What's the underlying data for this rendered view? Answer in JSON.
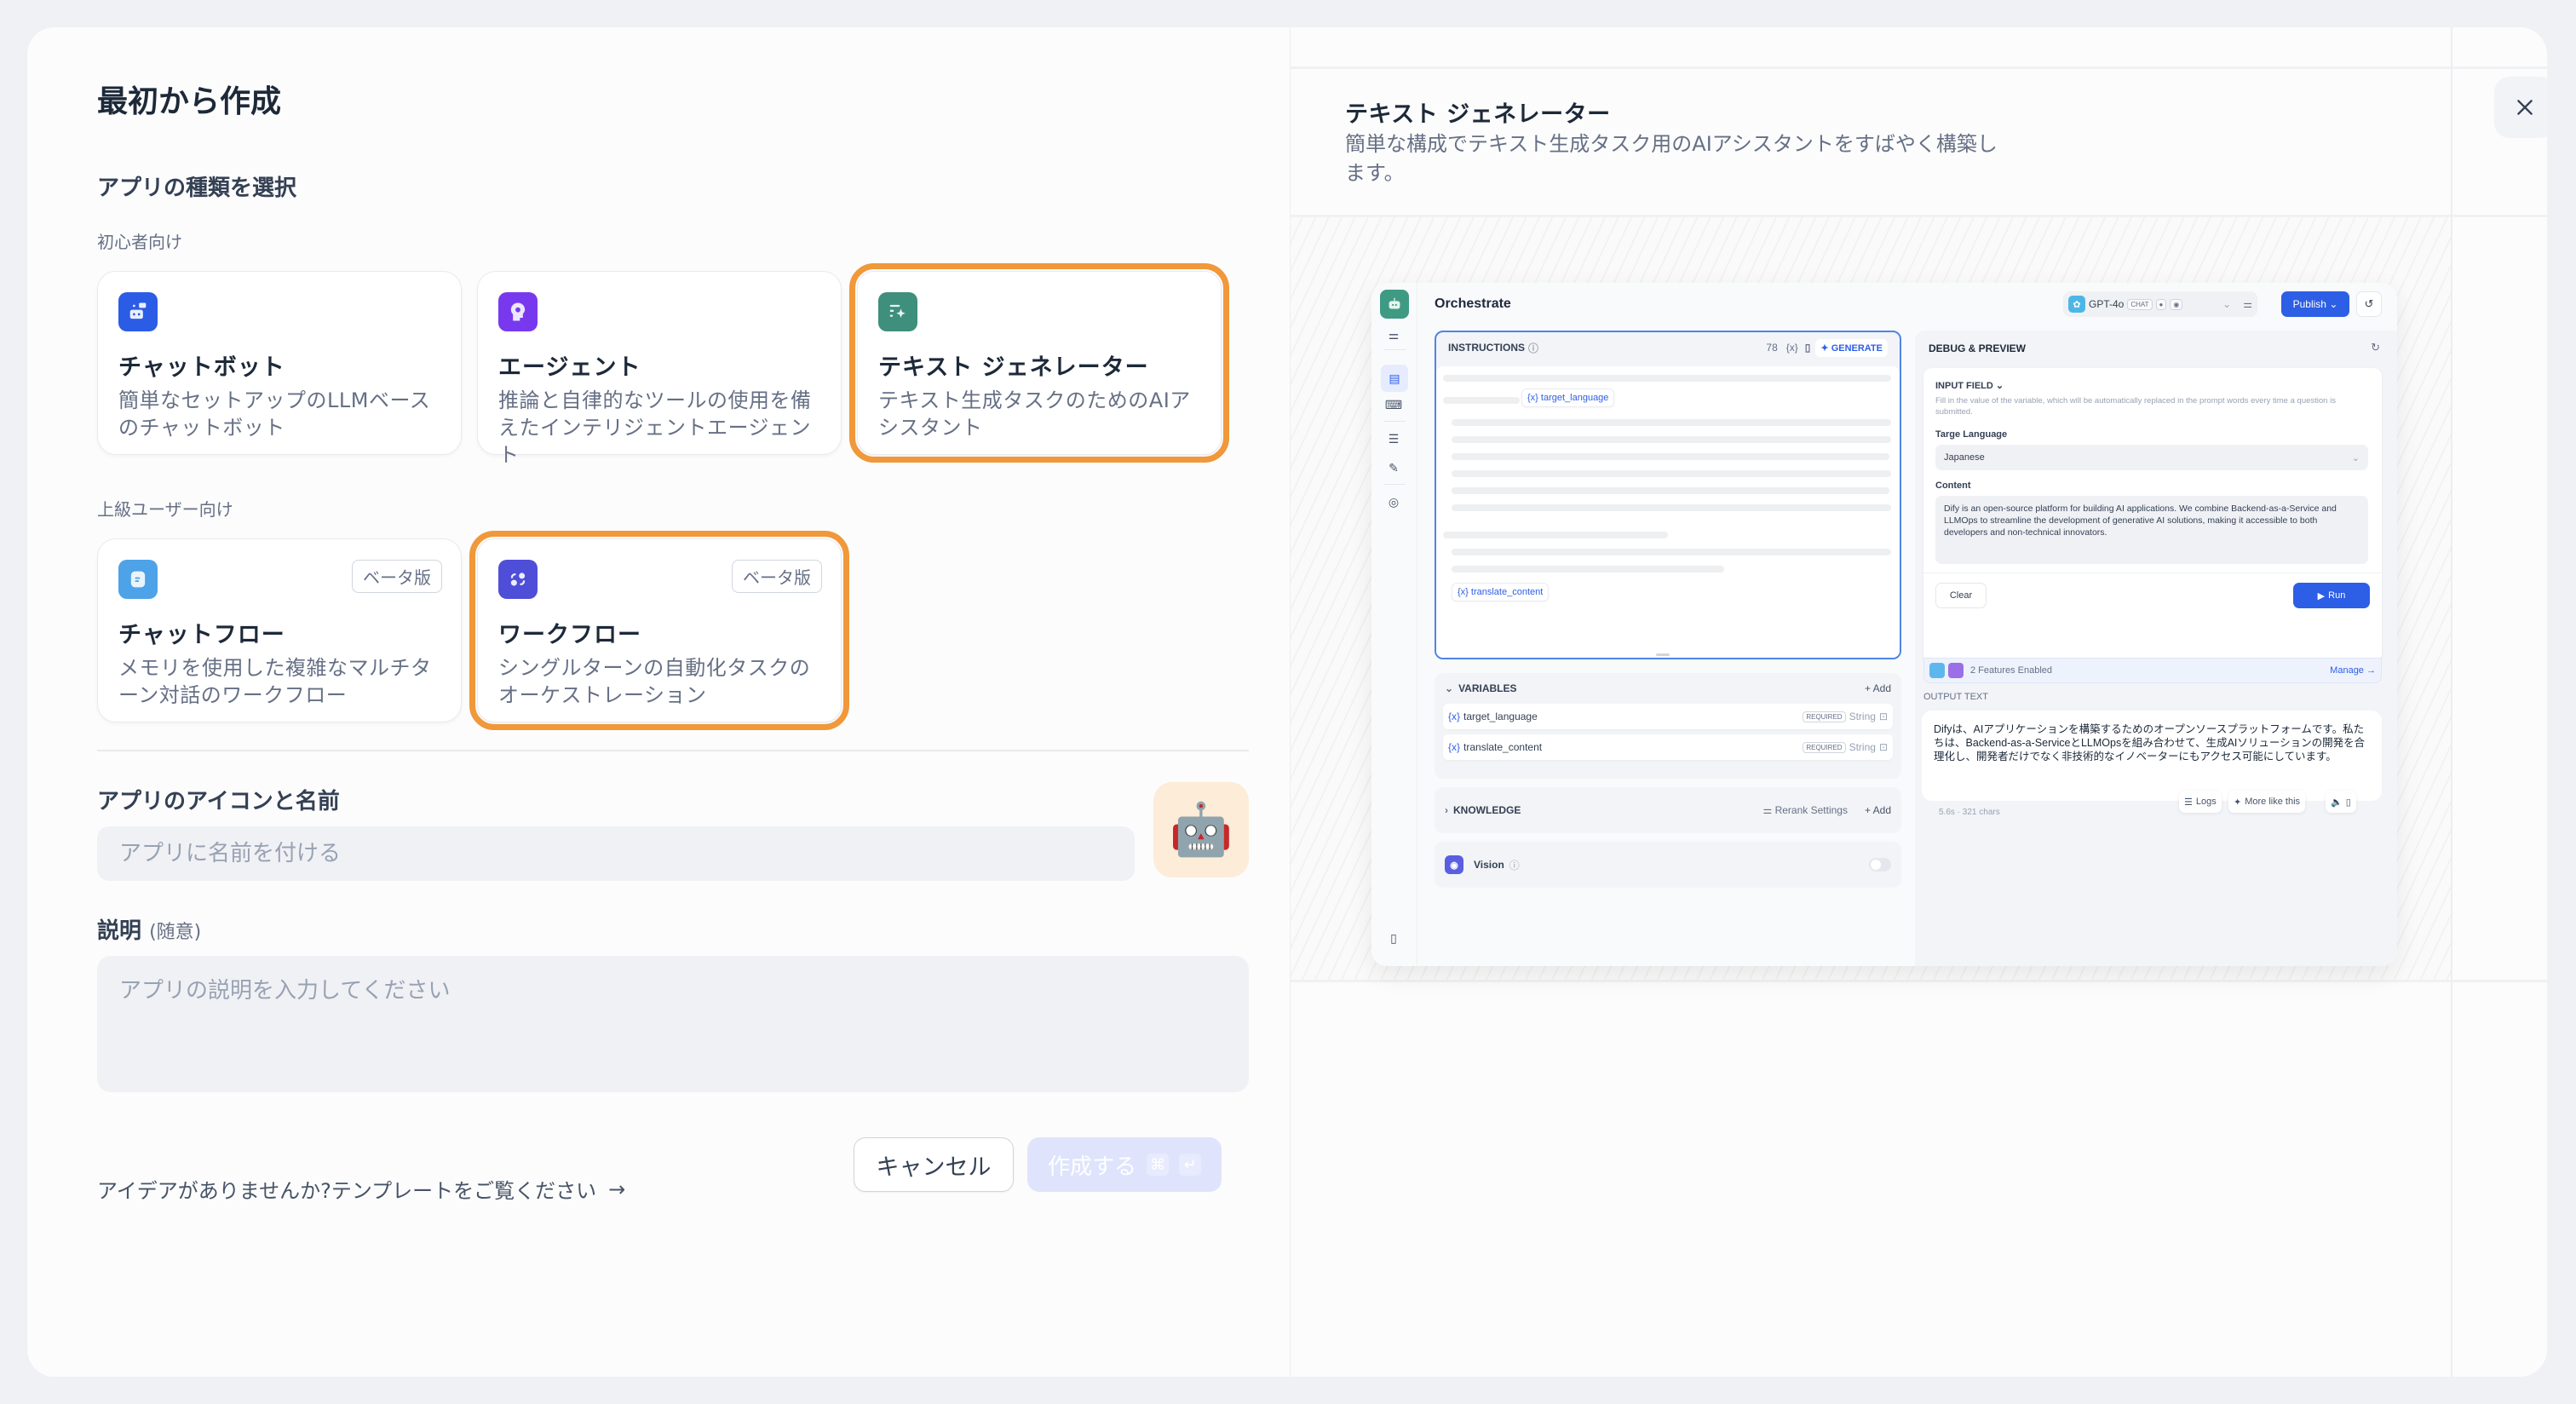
{
  "dialog": {
    "title": "最初から作成",
    "app_type_heading": "アプリの種類を選択",
    "groups": [
      {
        "label": "初心者向け",
        "cards": [
          {
            "name": "チャットボット",
            "desc": "簡単なセットアップのLLMベースのチャットボット",
            "icon": "chatbot-icon",
            "color": "#2b5ce6",
            "selected": false,
            "badge": null
          },
          {
            "name": "エージェント",
            "desc": "推論と自律的なツールの使用を備えたインテリジェントエージェント",
            "icon": "agent-icon",
            "color": "#7839ee",
            "selected": false,
            "badge": null
          },
          {
            "name": "テキスト ジェネレーター",
            "desc": "テキスト生成タスクのためのAIアシスタント",
            "icon": "text-generator-icon",
            "color": "#3f8f7d",
            "selected": true,
            "badge": null
          }
        ]
      },
      {
        "label": "上級ユーザー向け",
        "cards": [
          {
            "name": "チャットフロー",
            "desc": "メモリを使用した複雑なマルチターン対話のワークフロー",
            "icon": "chatflow-icon",
            "color": "#4ea2e8",
            "selected": false,
            "badge": "ベータ版"
          },
          {
            "name": "ワークフロー",
            "desc": "シングルターンの自動化タスクのオーケストレーション",
            "icon": "workflow-icon",
            "color": "#4f4ed8",
            "selected": true,
            "badge": "ベータ版"
          }
        ]
      }
    ],
    "highlight_color": "#f0983a",
    "icon_name_label": "アプリのアイコンと名前",
    "name_placeholder": "アプリに名前を付ける",
    "name_value": "",
    "app_emoji": "🤖",
    "description_label": "説明",
    "description_optional": "(随意)",
    "description_placeholder": "アプリの説明を入力してください",
    "description_value": "",
    "template_link": "アイデアがありませんか?テンプレートをご覧ください",
    "cancel_label": "キャンセル",
    "create_label": "作成する",
    "create_shortcut": [
      "⌘",
      "↵"
    ]
  },
  "preview": {
    "title": "テキスト ジェネレーター",
    "description": "簡単な構成でテキスト生成タスク用のAIアシスタントをすばやく構築します。",
    "screenshot": {
      "page_title": "Orchestrate",
      "model": {
        "name": "GPT-4o",
        "mode": "CHAT"
      },
      "publish_label": "Publish",
      "instructions": {
        "label": "INSTRUCTIONS",
        "char_count": "78",
        "var_symbol": "{x}",
        "generate_label": "GENERATE",
        "var_pills": [
          "{x} target_language",
          "{x} translate_content"
        ]
      },
      "variables": {
        "label": "VARIABLES",
        "add_label": "+ Add",
        "rows": [
          {
            "name": "target_language",
            "required": "REQUIRED",
            "type": "String"
          },
          {
            "name": "translate_content",
            "required": "REQUIRED",
            "type": "String"
          }
        ]
      },
      "knowledge": {
        "label": "KNOWLEDGE",
        "rerank_label": "Rerank Settings",
        "add_label": "+ Add"
      },
      "vision": {
        "label": "Vision",
        "enabled": false
      },
      "debug": {
        "heading": "DEBUG & PREVIEW",
        "input_field_label": "INPUT FIELD",
        "input_field_hint": "Fill in the value of the variable, which will be automatically replaced in the prompt words every time a question is submitted.",
        "lang_label": "Targe Language",
        "lang_value": "Japanese",
        "content_label": "Content",
        "content_value": "Dify is an open-source platform for building AI applications. We combine Backend-as-a-Service and LLMOps to streamline the development of generative AI solutions, making it accessible to both developers and non-technical innovators.",
        "clear_label": "Clear",
        "run_label": "Run",
        "features_label": "2 Features Enabled",
        "manage_label": "Manage",
        "output_label": "OUTPUT TEXT",
        "output_text": "Difyは、AIアプリケーションを構築するためのオープンソースプラットフォームです。私たちは、Backend-as-a-ServiceとLLMOpsを組み合わせて、生成AIソリューションの開発を合理化し、開発者だけでなく非技術的なイノベーターにもアクセス可能にしています。",
        "output_meta": "5.6s · 321 chars",
        "logs_label": "Logs",
        "more_like_this_label": "More like this"
      }
    }
  }
}
